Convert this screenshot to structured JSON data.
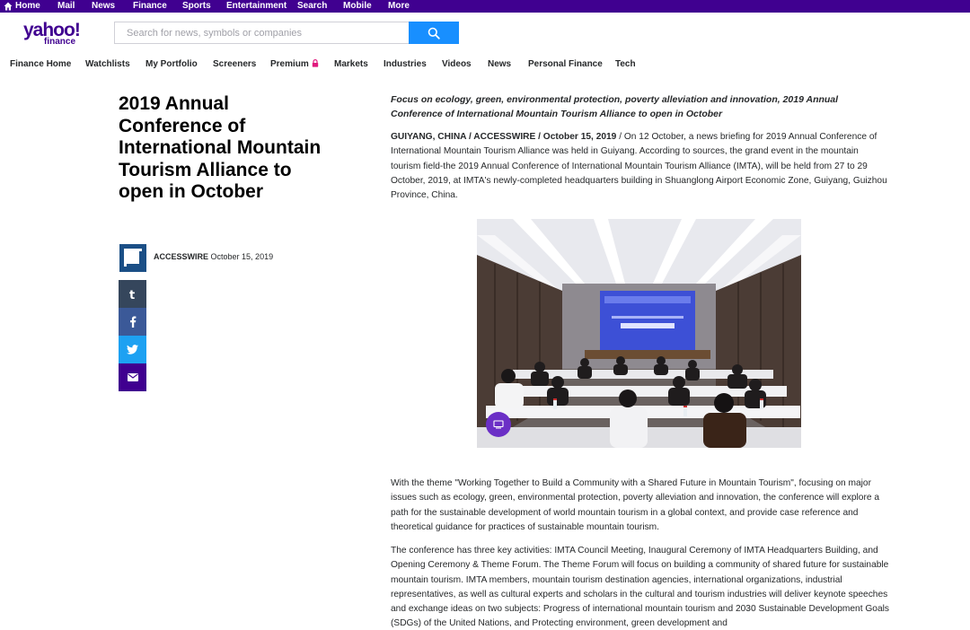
{
  "topbar": {
    "items": [
      "Home",
      "Mail",
      "News",
      "Finance",
      "Sports",
      "Entertainment",
      "Search",
      "Mobile",
      "More"
    ]
  },
  "brand": {
    "logo_text": "yahoo!",
    "logo_sub": "finance",
    "accent": "#400090",
    "search_button_color": "#188fff"
  },
  "search": {
    "placeholder": "Search for news, symbols or companies",
    "value": ""
  },
  "nav": {
    "items": [
      "Finance Home",
      "Watchlists",
      "My Portfolio",
      "Screeners",
      "Premium",
      "Markets",
      "Industries",
      "Videos",
      "News",
      "Personal Finance",
      "Tech"
    ]
  },
  "article": {
    "title": "2019 Annual Conference of International Mountain Tourism Alliance to open in October",
    "source": "ACCESSWIRE",
    "date": "October 15, 2019",
    "summary": "Focus on ecology, green, environmental protection, poverty alleviation and innovation, 2019 Annual Conference of International Mountain Tourism Alliance to open in October",
    "dateline": "GUIYANG, CHINA / ACCESSWIRE / October 15, 2019",
    "dateline_sep": " / ",
    "p1": "On 12 October, a news briefing for 2019 Annual Conference of International Mountain Tourism Alliance was held in Guiyang. According to sources, the grand event in the mountain tourism field-the 2019 Annual Conference of International Mountain Tourism Alliance (IMTA), will be held from 27 to 29 October, 2019, at IMTA's newly-completed headquarters building in Shuanglong Airport Economic Zone, Guiyang, Guizhou Province, China.",
    "p2": "With the theme \"Working Together to Build a Community with a Shared Future in Mountain Tourism\", focusing on major issues such as ecology, green, environmental protection, poverty alleviation and innovation, the conference will explore a path for the sustainable development of world mountain tourism in a global context, and provide case reference and theoretical guidance for practices of sustainable mountain tourism.",
    "p3": "The conference has three key activities: IMTA Council Meeting, Inaugural Ceremony of IMTA Headquarters Building, and Opening Ceremony & Theme Forum. The Theme Forum will focus on building a community of shared future for sustainable mountain tourism. IMTA members, mountain tourism destination agencies, international organizations, industrial representatives, as well as cultural experts and scholars in the cultural and tourism industries will deliver keynote speeches and exchange ideas on two subjects: Progress of international mountain tourism and 2030 Sustainable Development Goals (SDGs) of the United Nations, and Protecting environment, green development and"
  },
  "share": {
    "tumblr_color": "#35465c",
    "facebook_color": "#3b5998",
    "twitter_color": "#1da1f2",
    "mail_color": "#400090"
  }
}
